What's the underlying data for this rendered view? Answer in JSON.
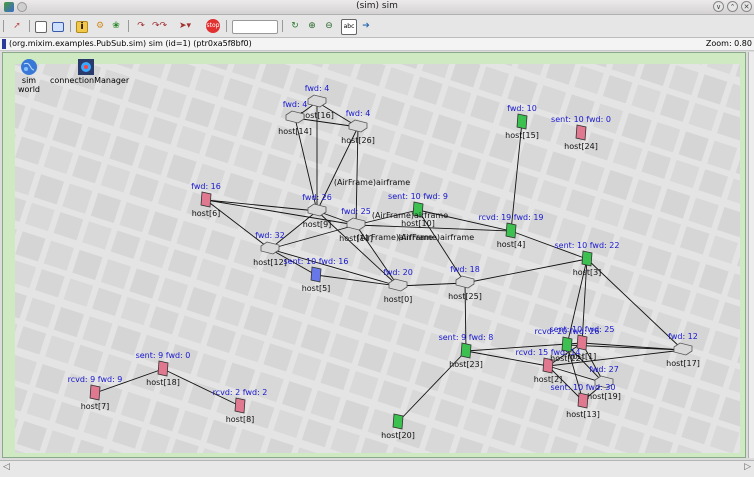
{
  "window": {
    "title": "(sim) sim",
    "buttons": [
      "∨",
      "⌃",
      "✕"
    ]
  },
  "infobar": {
    "path": "(org.mixim.examples.PubSub.sim) sim  (id=1)  (ptr0xa5f8bf0)",
    "zoom": "Zoom: 0.80"
  },
  "colors": {
    "canvas_border": "#cfe9c2",
    "label_blue": "#1818d0",
    "host_pink": "#e07890",
    "host_green": "#3cc050",
    "host_blue": "#6878e8",
    "router": "#d8d8d8"
  },
  "toolbar": {
    "icons": [
      "run-icon",
      "grid-icon",
      "module-icon",
      "info-icon",
      "settings-icon",
      "tree-icon",
      "step-back-icon",
      "step-icon",
      "fast-icon",
      "stop-icon",
      "event-field",
      "layout-icon",
      "zoom-in-icon",
      "zoom-out-icon",
      "abc-icon",
      "arrow-icon"
    ]
  },
  "scene": {
    "world_icon_label": "sim\nworld",
    "connection_manager_label": "connectionManager",
    "hosts": [
      {
        "id": "host16",
        "label": "host[16]",
        "status": "fwd: 4",
        "kind": "router"
      },
      {
        "id": "host14",
        "label": "host[14]",
        "status": "fwd: 4",
        "kind": "router"
      },
      {
        "id": "host26",
        "label": "host[26]",
        "status": "fwd: 4",
        "kind": "router"
      },
      {
        "id": "host15",
        "label": "host[15]",
        "status": "fwd: 10",
        "kind": "green"
      },
      {
        "id": "host24",
        "label": "host[24]",
        "status": "sent: 10 fwd: 0",
        "kind": "pink"
      },
      {
        "id": "host6",
        "label": "host[6]",
        "status": "fwd: 16",
        "kind": "pink"
      },
      {
        "id": "host9",
        "label": "host[9]",
        "status": "fwd: 26",
        "kind": "router"
      },
      {
        "id": "host10",
        "label": "host[10]",
        "status": "sent: 10 fwd: 9",
        "kind": "green"
      },
      {
        "id": "host11",
        "label": "host[11]",
        "status": "fwd: 25",
        "kind": "router"
      },
      {
        "id": "host12",
        "label": "host[12]",
        "status": "fwd: 32",
        "kind": "router"
      },
      {
        "id": "host5",
        "label": "host[5]",
        "status": "sent: 10 fwd: 16",
        "kind": "blue"
      },
      {
        "id": "host4",
        "label": "host[4]",
        "status": "rcvd: 19 fwd: 19",
        "kind": "green"
      },
      {
        "id": "host3",
        "label": "host[3]",
        "status": "sent: 10 fwd: 22",
        "kind": "green"
      },
      {
        "id": "host0",
        "label": "host[0]",
        "status": "fwd: 20",
        "kind": "router"
      },
      {
        "id": "host25",
        "label": "host[25]",
        "status": "fwd: 18",
        "kind": "router"
      },
      {
        "id": "host23",
        "label": "host[23]",
        "status": "sent: 9 fwd: 8",
        "kind": "green"
      },
      {
        "id": "host17",
        "label": "host[17]",
        "status": "fwd: 12",
        "kind": "router"
      },
      {
        "id": "host2",
        "label": "host[2]",
        "status": "rcvd: 15 fwd: 14",
        "kind": "pink"
      },
      {
        "id": "host1",
        "label": "host[1]",
        "status": "sent: 10 fwd: 25",
        "kind": "pink"
      },
      {
        "id": "host22",
        "label": "host[22]",
        "status": "rcvd: 20 fwd: 26",
        "kind": "green"
      },
      {
        "id": "host19",
        "label": "host[19]",
        "status": "fwd: 27",
        "kind": "router"
      },
      {
        "id": "host13",
        "label": "host[13]",
        "status": "sent: 10 fwd: 30",
        "kind": "pink"
      },
      {
        "id": "host7",
        "label": "host[7]",
        "status": "rcvd: 9 fwd: 9",
        "kind": "pink"
      },
      {
        "id": "host18",
        "label": "host[18]",
        "status": "sent: 9 fwd: 0",
        "kind": "pink"
      },
      {
        "id": "host8",
        "label": "host[8]",
        "status": "rcvd: 2 fwd: 2",
        "kind": "pink"
      },
      {
        "id": "host20",
        "label": "host[20]",
        "status": "",
        "kind": "green"
      }
    ],
    "messages": [
      "(AirFrame)airframe",
      "(AirFrame)airframe",
      "(AirFrame)airframe",
      "(AirFrame)airframe"
    ]
  }
}
